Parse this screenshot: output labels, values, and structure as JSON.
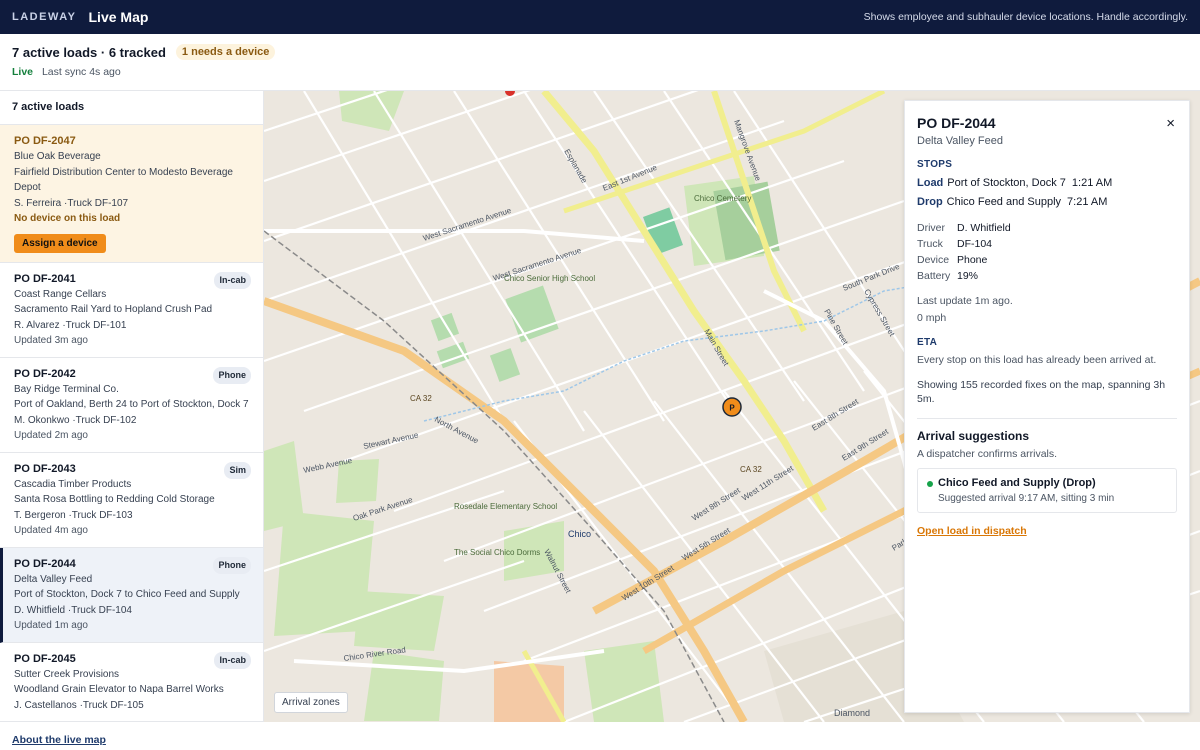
{
  "topbar": {
    "brand": "LADEWAY",
    "title": "Live Map",
    "note": "Shows employee and subhauler device locations. Handle accordingly."
  },
  "summary": {
    "title": "7 active loads · 6 tracked",
    "needs_badge": "1 needs a device",
    "live": "Live",
    "sync": "Last sync 4s ago"
  },
  "sidebar": {
    "header": "7 active loads",
    "loads": [
      {
        "po": "PO DF-2047",
        "customer": "Blue Oak Beverage",
        "route": "Fairfield Distribution Center to Modesto Beverage Depot",
        "crew": "S. Ferreira ·Truck DF-107",
        "status": "No device on this load",
        "action": "Assign a device"
      },
      {
        "po": "PO DF-2041",
        "tag": "In-cab",
        "customer": "Coast Range Cellars",
        "route": "Sacramento Rail Yard to Hopland Crush Pad",
        "crew": "R. Alvarez ·Truck DF-101",
        "updated": "Updated 3m ago"
      },
      {
        "po": "PO DF-2042",
        "tag": "Phone",
        "customer": "Bay Ridge Terminal Co.",
        "route": "Port of Oakland, Berth 24 to Port of Stockton, Dock 7",
        "crew": "M. Okonkwo ·Truck DF-102",
        "updated": "Updated 2m ago"
      },
      {
        "po": "PO DF-2043",
        "tag": "Sim",
        "customer": "Cascadia Timber Products",
        "route": "Santa Rosa Bottling to Redding Cold Storage",
        "crew": "T. Bergeron ·Truck DF-103",
        "updated": "Updated 4m ago"
      },
      {
        "po": "PO DF-2044",
        "tag": "Phone",
        "customer": "Delta Valley Feed",
        "route": "Port of Stockton, Dock 7 to Chico Feed and Supply",
        "crew": "D. Whitfield ·Truck DF-104",
        "updated": "Updated 1m ago"
      },
      {
        "po": "PO DF-2045",
        "tag": "In-cab",
        "customer": "Sutter Creek Provisions",
        "route": "Woodland Grain Elevator to Napa Barrel Works",
        "crew": "J. Castellanos ·Truck DF-105",
        "updated": ""
      }
    ]
  },
  "map": {
    "zones_button": "Arrival zones",
    "marker_label": "P",
    "labels": {
      "cemetery": "Chico Cemetery",
      "school": "Chico Senior High School",
      "city": "Chico",
      "elementary": "Rosedale Elementary School",
      "dorm": "The Social Chico Dorms",
      "diamond": "Diamond",
      "ca32a": "CA 32",
      "ca32b": "CA 32",
      "north_ave": "North Avenue",
      "esplanade": "Esplanade",
      "e1st": "East 1st Avenue",
      "main": "Main Street",
      "e8th": "East 8th Street",
      "e9th": "East 9th Street",
      "walnut": "Walnut Street",
      "w5th": "West 5th Street",
      "w10th": "West 10th Street",
      "river": "Chico River Road",
      "pine": "Pine Street",
      "cypress": "Cypress Street",
      "mangrove": "Mangrove Avenue",
      "w8th": "West 8th Street",
      "w11th": "West 11th Street",
      "oak": "Oak Park Avenue",
      "west_sac": "West Sacramento Avenue",
      "sac_ave": "West Sacramento Avenue",
      "s_park": "South Park Drive",
      "stewart": "Stewart Avenue",
      "webb": "Webb Avenue",
      "park_ave": "Park Avenue"
    }
  },
  "detail": {
    "po": "PO DF-2044",
    "customer": "Delta Valley Feed",
    "close": "×",
    "stops_label": "STOPS",
    "stops": [
      {
        "kind": "Load",
        "place": "Port of Stockton, Dock 7",
        "time": "1:21 AM"
      },
      {
        "kind": "Drop",
        "place": "Chico Feed and Supply",
        "time": "7:21 AM"
      }
    ],
    "driver_key": "Driver",
    "driver": "D. Whitfield",
    "truck_key": "Truck",
    "truck": "DF-104",
    "device_key": "Device",
    "device": "Phone",
    "battery_key": "Battery",
    "battery": "19%",
    "last_update": "Last update 1m ago.",
    "speed": "0 mph",
    "eta_label": "ETA",
    "eta_text": "Every stop on this load has already been arrived at.",
    "fixes_text": "Showing 155 recorded fixes on the map, spanning 3h 5m.",
    "arrival_title": "Arrival suggestions",
    "arrival_sub": "A dispatcher confirms arrivals.",
    "suggestion_name": "Chico Feed and Supply (Drop)",
    "suggestion_detail": "Suggested arrival 9:17 AM, sitting 3 min",
    "open_link": "Open load in dispatch"
  },
  "footer": {
    "link": "About the live map"
  },
  "colors": {
    "topbar": "#0f1b3d",
    "accent": "#f08c1a",
    "live": "#15803d",
    "park": "#cfe6b8",
    "highway": "#f5c883"
  }
}
